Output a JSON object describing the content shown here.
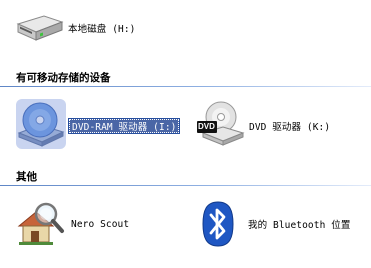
{
  "hard_disks": {
    "items": [
      {
        "label": "本地磁盘 (H:)",
        "icon": "hard-disk-icon"
      }
    ]
  },
  "removable_section": {
    "title": "有可移动存储的设备",
    "items": [
      {
        "label": "DVD-RAM 驱动器 (I:)",
        "icon": "dvd-ram-drive-icon",
        "selected": true
      },
      {
        "label": "DVD 驱动器 (K:)",
        "icon": "dvd-drive-icon",
        "badge": "DVD"
      }
    ]
  },
  "other_section": {
    "title": "其他",
    "items": [
      {
        "label": "Nero Scout",
        "icon": "nero-scout-icon"
      },
      {
        "label": "我的 Bluetooth 位置",
        "icon": "bluetooth-icon"
      }
    ]
  },
  "colors": {
    "selection_bg": "#4a66a6",
    "section_rule": "#5f86c6"
  }
}
